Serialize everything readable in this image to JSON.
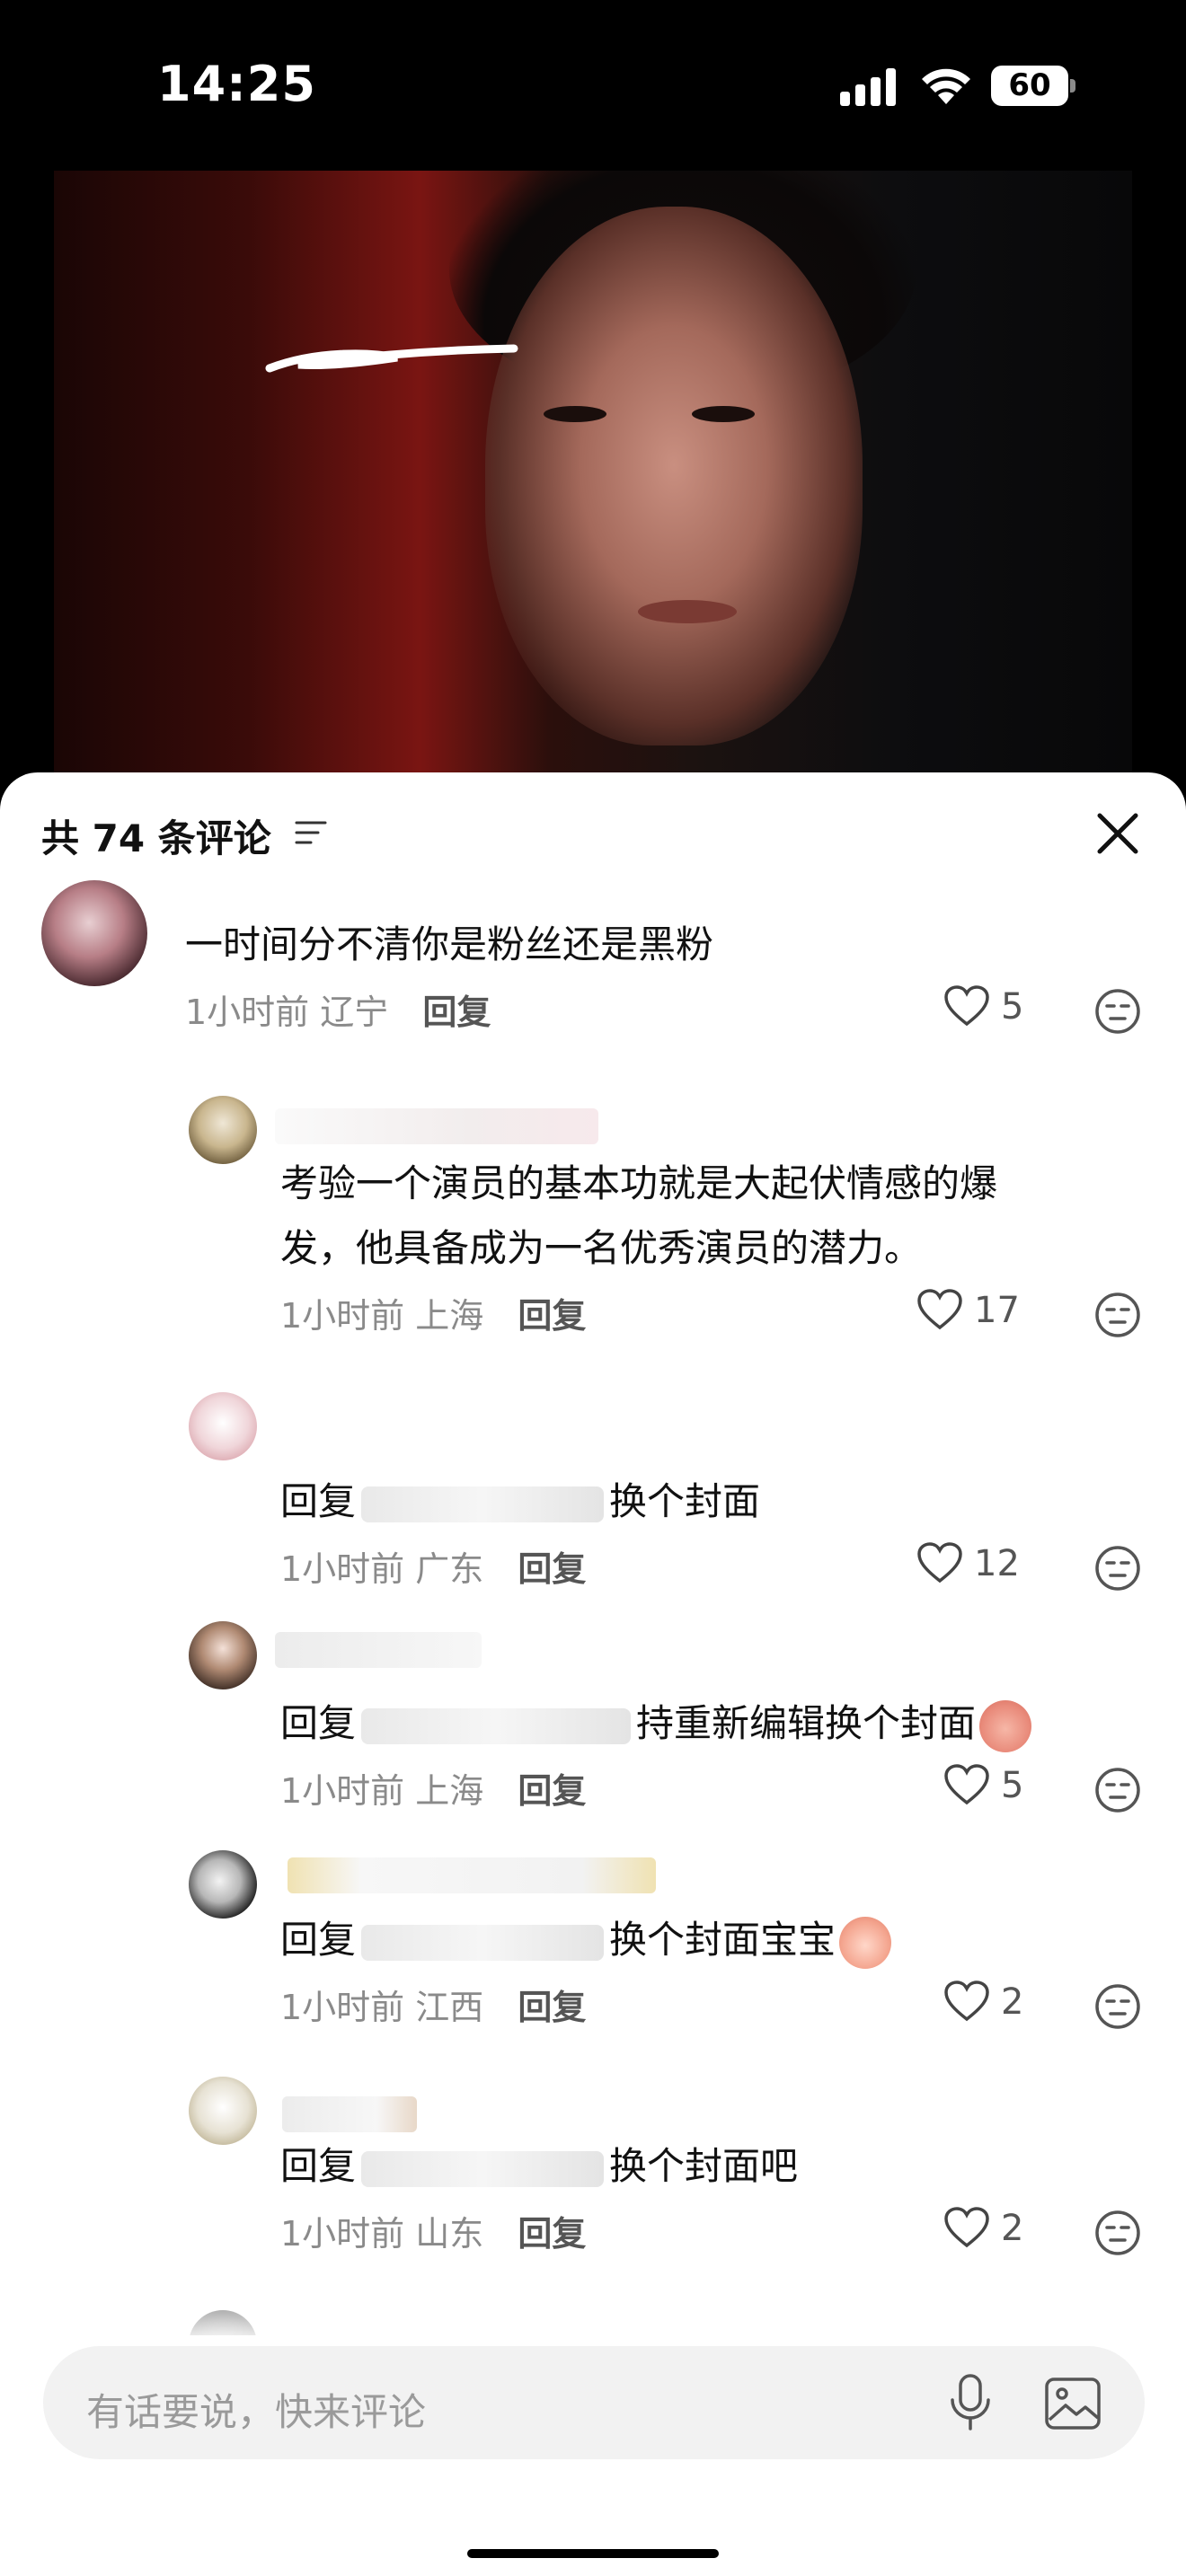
{
  "status_bar": {
    "time": "14:25",
    "battery": "60"
  },
  "comments_header": {
    "title": "共 74 条评论",
    "sort_icon": "sort-lines-icon",
    "close_icon": "close-x-icon"
  },
  "comments": [
    {
      "text": "一时间分不清你是粉丝还是黑粉",
      "time": "1小时前",
      "location": "辽宁",
      "reply_label": "回复",
      "likes": "5"
    },
    {
      "text_line1": "考验一个演员的基本功就是大起伏情感的爆",
      "text_line2": "发，他具备成为一名优秀演员的潜力。",
      "time": "1小时前",
      "location": "上海",
      "reply_label": "回复",
      "likes": "17"
    },
    {
      "prefix": "回复",
      "text": "换个封面",
      "time": "1小时前",
      "location": "广东",
      "reply_label": "回复",
      "likes": "12"
    },
    {
      "prefix": "回复",
      "text": "持重新编辑换个封面",
      "time": "1小时前",
      "location": "上海",
      "reply_label": "回复",
      "likes": "5"
    },
    {
      "prefix": "回复",
      "text": "换个封面宝宝",
      "time": "1小时前",
      "location": "江西",
      "reply_label": "回复",
      "likes": "2"
    },
    {
      "prefix": "回复",
      "text": "换个封面吧",
      "time": "1小时前",
      "location": "山东",
      "reply_label": "回复",
      "likes": "2"
    }
  ],
  "input": {
    "placeholder": "有话要说，快来评论",
    "mic_icon": "microphone-icon",
    "image_icon": "image-icon"
  },
  "colors": {
    "accent_text": "#111111",
    "meta_text": "#8a8a8a",
    "sheet_bg": "#ffffff",
    "input_bg": "#f2f2f2"
  }
}
